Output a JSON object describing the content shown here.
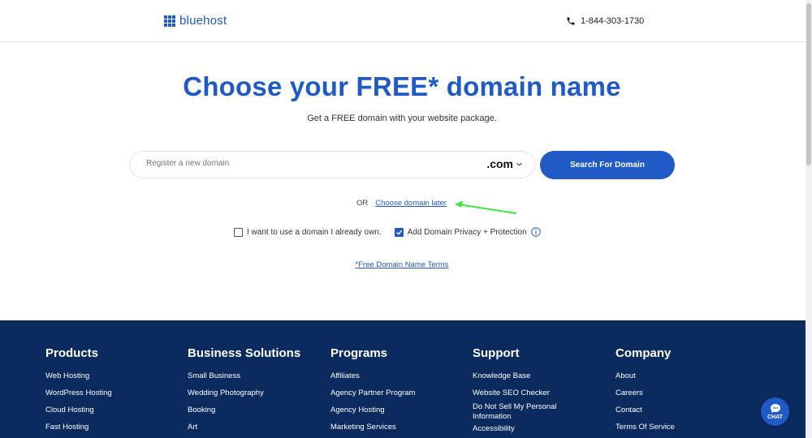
{
  "header": {
    "logo_text": "bluehost",
    "phone": "1-844-303-1730"
  },
  "hero": {
    "title": "Choose your FREE* domain name",
    "subtitle": "Get a FREE domain with your website package."
  },
  "search": {
    "placeholder": "Register a new domain",
    "tld": ".com",
    "button_label": "Search For Domain"
  },
  "alternate": {
    "or_label": "OR",
    "link_label": "Choose domain later"
  },
  "options": {
    "own_domain_label": "I want to use a domain I already own.",
    "own_domain_checked": false,
    "privacy_label": "Add Domain Privacy + Protection",
    "privacy_checked": true
  },
  "terms_link": "*Free Domain Name Terms",
  "footer": {
    "columns": [
      {
        "heading": "Products",
        "items": [
          "Web Hosting",
          "WordPress Hosting",
          "Cloud Hosting",
          "Fast Hosting"
        ]
      },
      {
        "heading": "Business Solutions",
        "items": [
          "Small Business",
          "Wedding Photography",
          "Booking",
          "Art"
        ]
      },
      {
        "heading": "Programs",
        "items": [
          "Affiliates",
          "Agency Partner Program",
          "Agency Hosting",
          "Marketing Services"
        ]
      },
      {
        "heading": "Support",
        "items": [
          "Knowledge Base",
          "Website SEO Checker",
          "Do Not Sell My Personal Information",
          "Accessibility"
        ]
      },
      {
        "heading": "Company",
        "items": [
          "About",
          "Careers",
          "Contact",
          "Terms Of Service"
        ]
      }
    ]
  },
  "chat": {
    "label": "CHAT"
  },
  "colors": {
    "brand_blue": "#1f5ac7",
    "footer_navy": "#0b2a5e",
    "annotation_arrow": "#3ee83a"
  }
}
